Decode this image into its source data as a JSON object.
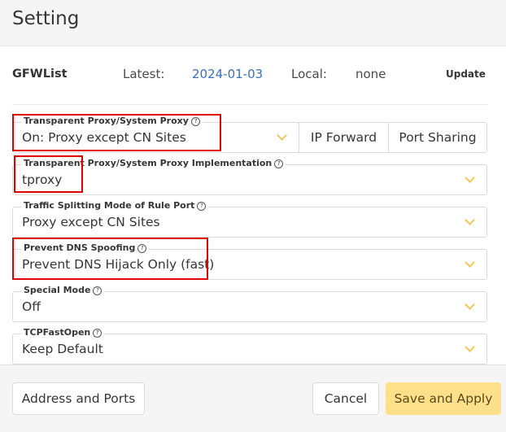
{
  "header": {
    "title": "Setting"
  },
  "gfwlist": {
    "title": "GFWList",
    "latest_label": "Latest:",
    "latest_value": "2024-01-03",
    "local_label": "Local:",
    "local_value": "none",
    "update_label": "Update"
  },
  "fields": {
    "transparent_proxy": {
      "label": "Transparent Proxy/System Proxy",
      "value": "On: Proxy except CN Sites"
    },
    "implementation": {
      "label": "Transparent Proxy/System Proxy Implementation",
      "value": "tproxy"
    },
    "traffic_splitting": {
      "label": "Traffic Splitting Mode of Rule Port",
      "value": "Proxy except CN Sites"
    },
    "dns_spoofing": {
      "label": "Prevent DNS Spoofing",
      "value": "Prevent DNS Hijack Only (fast)"
    },
    "special_mode": {
      "label": "Special Mode",
      "value": "Off"
    },
    "tcp_fast_open": {
      "label": "TCPFastOpen",
      "value": "Keep Default"
    }
  },
  "buttons": {
    "ip_forward": "IP Forward",
    "port_sharing": "Port Sharing",
    "address_ports": "Address and Ports",
    "cancel": "Cancel",
    "save_apply": "Save and Apply"
  },
  "colors": {
    "accent_yellow": "#ffe08a",
    "highlight_red": "#e00000",
    "link_blue": "#3b6fc2"
  },
  "icons": {
    "help": "question-circle-icon",
    "dropdown": "chevron-down-icon"
  }
}
